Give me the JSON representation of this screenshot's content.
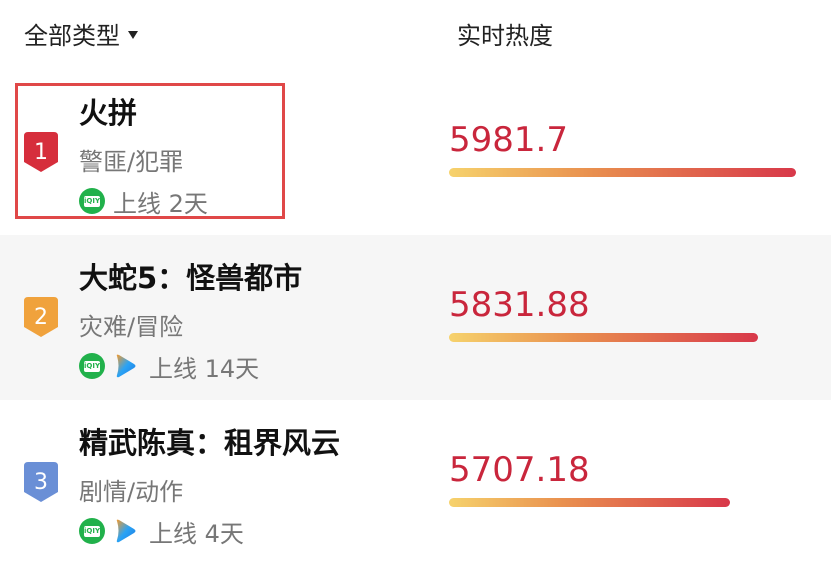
{
  "header": {
    "filter_label": "全部类型",
    "heat_column_label": "实时热度"
  },
  "items": [
    {
      "rank": "1",
      "rank_color": "#d62e3c",
      "title": "火拼",
      "genre": "警匪/犯罪",
      "platforms": [
        "iqiyi-icon"
      ],
      "online": "上线 2天",
      "heat": "5981.7",
      "heat_fraction": 1.0,
      "selected": true
    },
    {
      "rank": "2",
      "rank_color": "#f0a23c",
      "title": "大蛇5：怪兽都市",
      "genre": "灾难/冒险",
      "platforms": [
        "iqiyi-icon",
        "tencent-video-icon"
      ],
      "online": "上线 14天",
      "heat": "5831.88",
      "heat_fraction": 0.89,
      "selected": false
    },
    {
      "rank": "3",
      "rank_color": "#6a8fd6",
      "title": "精武陈真：租界风云",
      "genre": "剧情/动作",
      "platforms": [
        "iqiyi-icon",
        "tencent-video-icon"
      ],
      "online": "上线 4天",
      "heat": "5707.18",
      "heat_fraction": 0.81,
      "selected": false
    }
  ]
}
